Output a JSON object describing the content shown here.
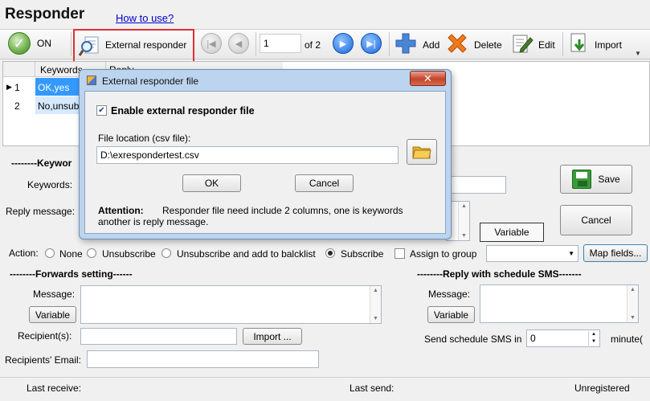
{
  "app": {
    "title": "Responder",
    "help_link": "How to use?"
  },
  "toolbar": {
    "on_label": "ON",
    "external_responder_label": "External responder",
    "page_current": "1",
    "page_of": "of 2",
    "add_label": "Add",
    "delete_label": "Delete",
    "edit_label": "Edit",
    "import_label": "Import"
  },
  "grid": {
    "columns": [
      "Keywords",
      "Reply"
    ],
    "rows": [
      {
        "num": "1",
        "keywords": "OK,yes"
      },
      {
        "num": "2",
        "keywords": "No,unsub"
      }
    ]
  },
  "keyword_section": {
    "header": "--------Keywor",
    "keywords_label": "Keywords:",
    "reply_label": "Reply message:",
    "save_label": "Save",
    "cancel_label": "Cancel",
    "variable_label": "Variable"
  },
  "action": {
    "label": "Action:",
    "options": [
      "None",
      "Unsubscribe",
      "Unsubscribe and add to balcklist",
      "Subscribe"
    ],
    "assign_group_label": "Assign to group",
    "map_fields_label": "Map fields..."
  },
  "forwards": {
    "header": "--------Forwards setting------",
    "message_label": "Message:",
    "variable_label": "Variable",
    "recipients_label": "Recipient(s):",
    "import_label": "Import ...",
    "email_label": "Recipients' Email:"
  },
  "schedule": {
    "header": "--------Reply with schedule SMS-------",
    "message_label": "Message:",
    "variable_label": "Variable",
    "send_label": "Send schedule SMS in",
    "send_value": "0",
    "unit_label": "minute("
  },
  "status": {
    "last_receive": "Last receive:",
    "last_send": "Last send:",
    "registration": "Unregistered"
  },
  "dialog": {
    "title": "External responder file",
    "enable_label": "Enable external responder file",
    "enable_checked": true,
    "file_location_label": "File location (csv file):",
    "file_path": "D:\\exrespondertest.csv",
    "ok_label": "OK",
    "cancel_label": "Cancel",
    "attention_title": "Attention:",
    "attention_text": "Responder file need include 2 columns, one is keywords another is reply message."
  },
  "colors": {
    "selection": "#3399ff",
    "dialog_title": "#bcd4ee",
    "highlight_border": "#e03030"
  }
}
